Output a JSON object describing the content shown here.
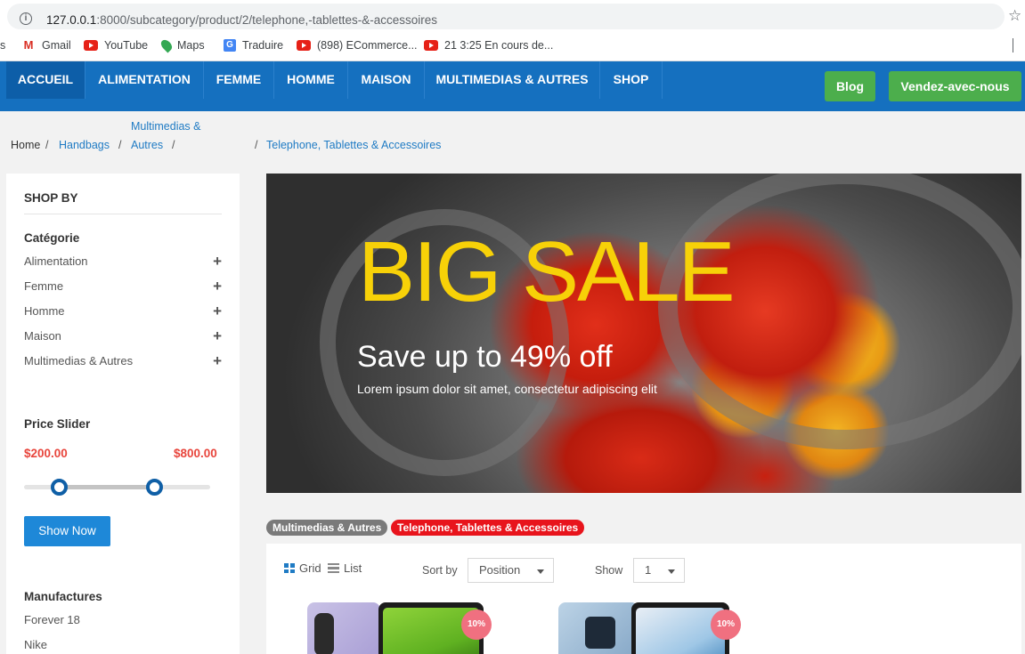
{
  "browser": {
    "url_host": "127.0.0.1",
    "url_rest": ":8000/subcategory/product/2/telephone,-tablettes-&-accessoires",
    "bookmarks": {
      "cut": "s",
      "gmail": "Gmail",
      "youtube": "YouTube",
      "maps": "Maps",
      "traduire": "Traduire",
      "ecommerce": "(898) ECommerce...",
      "cours": "21 3:25 En cours de..."
    }
  },
  "nav": {
    "items": [
      "ACCUEIL",
      "ALIMENTATION",
      "FEMME",
      "HOMME",
      "MAISON",
      "MULTIMEDIAS & AUTRES",
      "SHOP"
    ],
    "blog": "Blog",
    "sell": "Vendez-avec-nous"
  },
  "breadcrumb": {
    "home": "Home",
    "handbags": "Handbags",
    "multimedias_line1": "Multimedias &",
    "multimedias_line2": "Autres",
    "current": "Telephone, Tablettes & Accessoires",
    "sep": "/"
  },
  "sidebar": {
    "title": "SHOP BY",
    "category_heading": "Catégorie",
    "categories": [
      "Alimentation",
      "Femme",
      "Homme",
      "Maison",
      "Multimedias & Autres"
    ],
    "price_heading": "Price Slider",
    "price_min": "$200.00",
    "price_max": "$800.00",
    "price_range_fraction": [
      0.19,
      0.7
    ],
    "show_button": "Show Now",
    "manufacturers_heading": "Manufactures",
    "manufacturers": [
      "Forever 18",
      "Nike"
    ]
  },
  "banner": {
    "title": "BIG SALE",
    "subtitle": "Save up to 49% off",
    "lorem": "Lorem ipsum dolor sit amet, consectetur adipiscing elit"
  },
  "tags": {
    "parent": "Multimedias & Autres",
    "current": "Telephone, Tablettes & Accessoires",
    "parent_color": "#7a7a7a",
    "current_color": "#e8141c"
  },
  "toolbar": {
    "grid": "Grid",
    "list": "List",
    "sort_label": "Sort by",
    "sort_value": "Position",
    "show_label": "Show",
    "show_value": "1"
  },
  "products": [
    {
      "badge": "10%"
    },
    {
      "badge": "10%"
    }
  ],
  "colors": {
    "nav_bg": "#1570bf",
    "nav_active": "#0d5ea8",
    "green_button": "#4cae4c",
    "price_red": "#e8453c",
    "link_blue": "#1f7bc4",
    "banner_title": "#f7d108"
  }
}
